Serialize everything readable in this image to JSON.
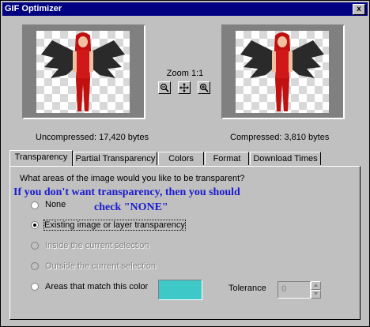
{
  "window": {
    "title": "GIF Optimizer",
    "close_label": "x"
  },
  "preview": {
    "zoom_label": "Zoom 1:1",
    "uncompressed": "Uncompressed:  17,420 bytes",
    "compressed": "Compressed: 3,810 bytes"
  },
  "tabs": [
    {
      "label": "Transparency",
      "active": true
    },
    {
      "label": "Partial Transparency"
    },
    {
      "label": "Colors"
    },
    {
      "label": "Format"
    },
    {
      "label": "Download Times"
    }
  ],
  "panel": {
    "question": "What areas of the image would you like to be transparent?",
    "annotation_line1": "If you don't want transparency, then you should",
    "annotation_line2": "check \"NONE\"",
    "options": [
      {
        "label": "None",
        "selected": false,
        "enabled": true
      },
      {
        "label": "Existing image or layer transparency",
        "selected": true,
        "enabled": true
      },
      {
        "label": "Inside the current selection",
        "selected": false,
        "enabled": false
      },
      {
        "label": "Outside the current selection",
        "selected": false,
        "enabled": false
      },
      {
        "label": "Areas that match this color",
        "selected": false,
        "enabled": true
      }
    ],
    "match_color": "#3ec8c8",
    "tolerance_label": "Tolerance",
    "tolerance_value": "0"
  }
}
